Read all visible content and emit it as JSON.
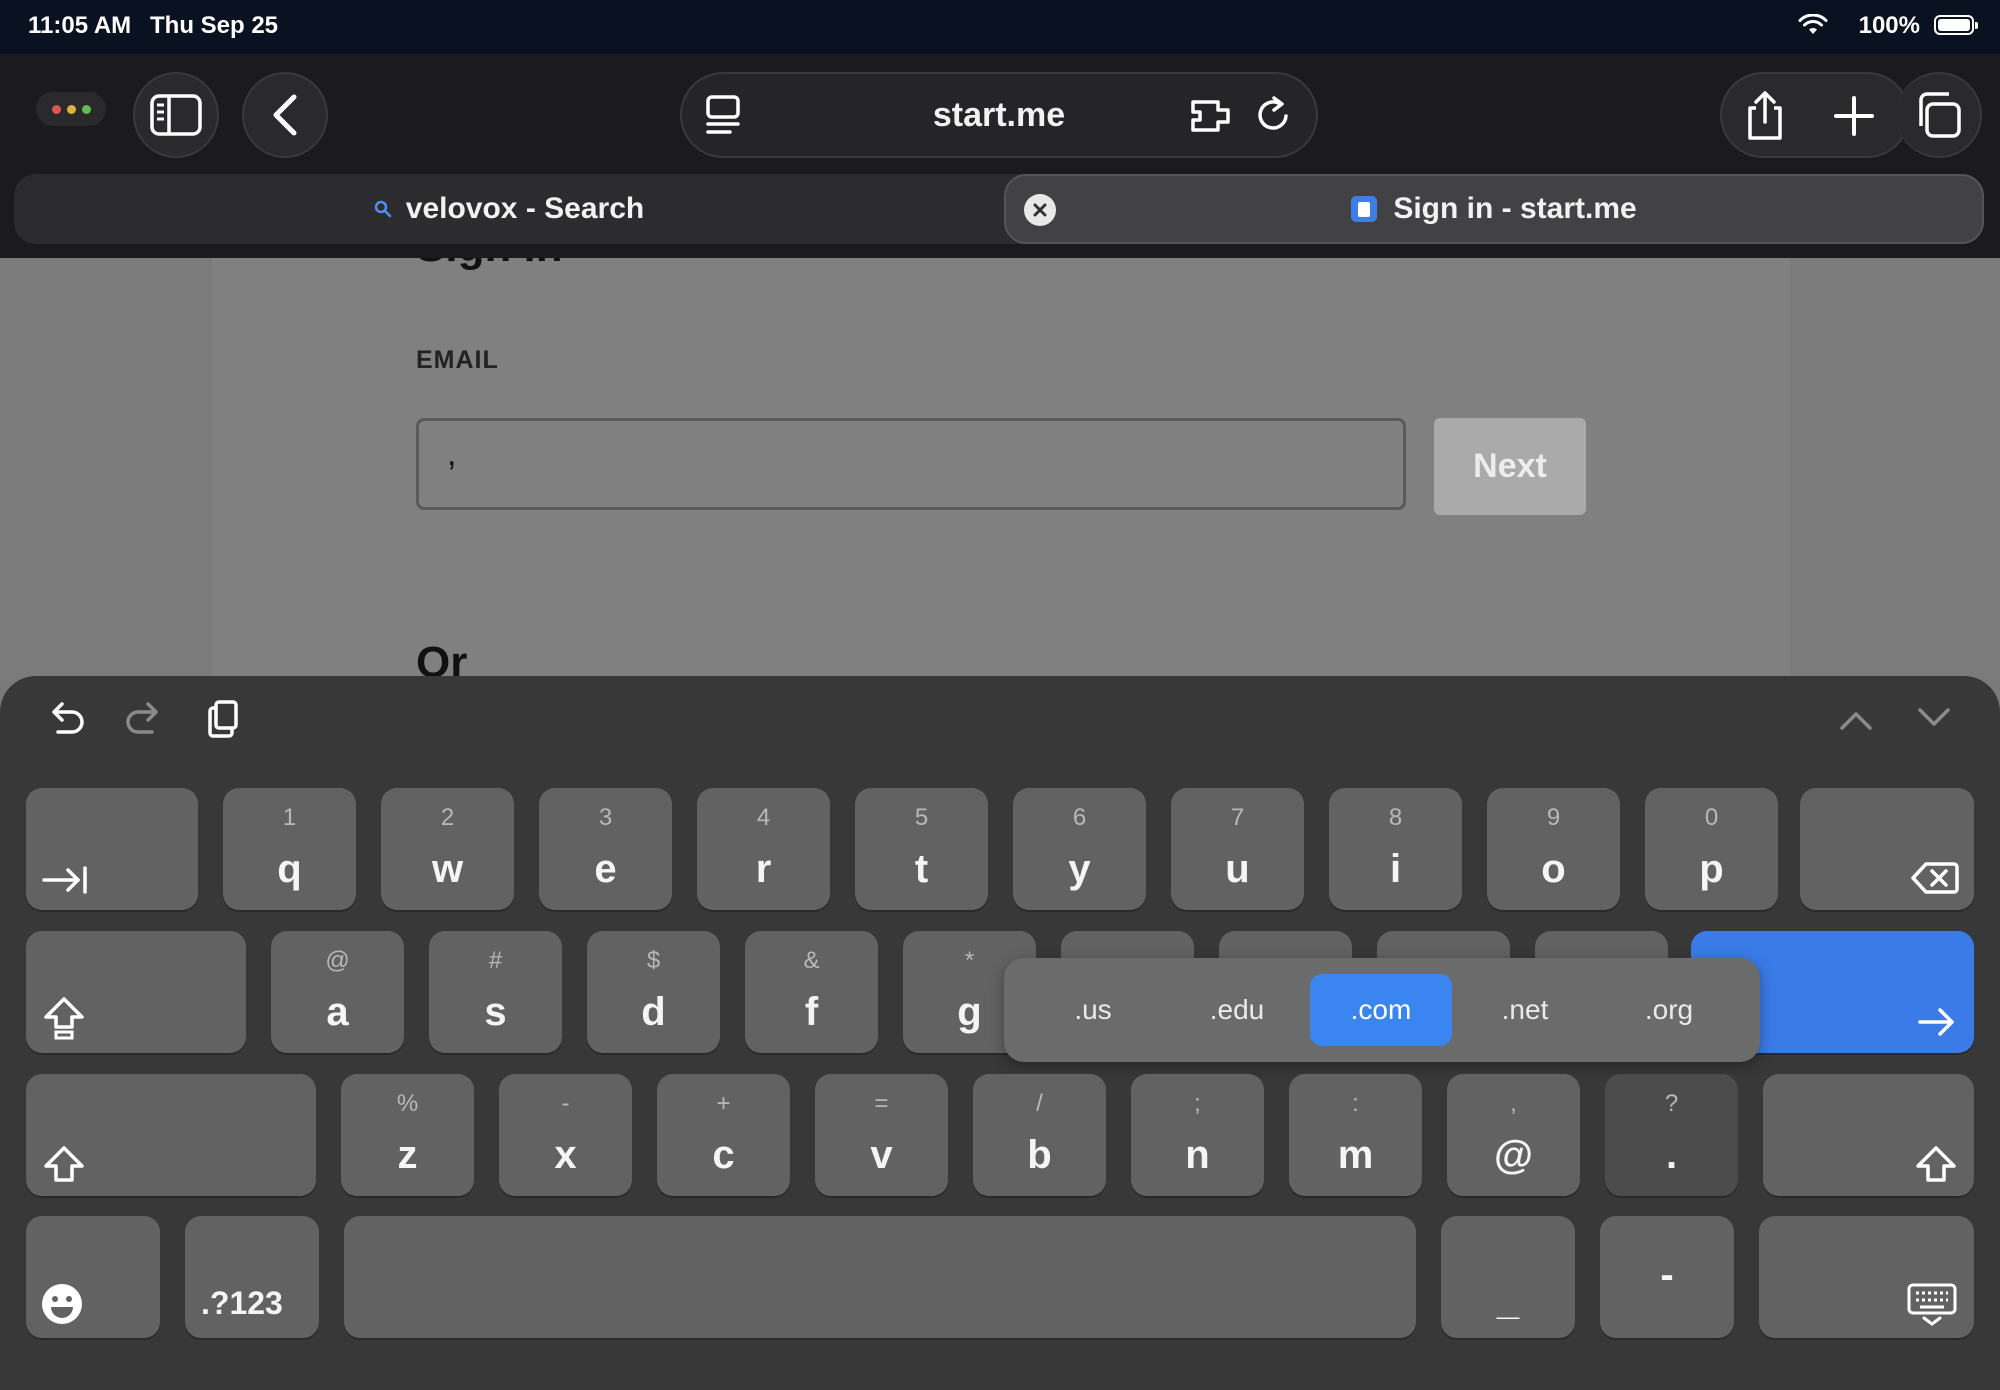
{
  "status_bar": {
    "time": "11:05 AM",
    "date": "Thu Sep 25",
    "battery": "100%"
  },
  "browser": {
    "address": "start.me",
    "tabs": [
      {
        "label": "velovox - Search",
        "icon": "search-icon"
      },
      {
        "label": "Sign in - start.me",
        "icon": "startme-favicon"
      }
    ]
  },
  "page": {
    "heading": "Sign in",
    "email_label": "EMAIL",
    "email_value": ",",
    "next_label": "Next",
    "or_label": "Or"
  },
  "keyboard": {
    "row1": [
      {
        "main": "q",
        "alt": "1"
      },
      {
        "main": "w",
        "alt": "2"
      },
      {
        "main": "e",
        "alt": "3"
      },
      {
        "main": "r",
        "alt": "4"
      },
      {
        "main": "t",
        "alt": "5"
      },
      {
        "main": "y",
        "alt": "6"
      },
      {
        "main": "u",
        "alt": "7"
      },
      {
        "main": "i",
        "alt": "8"
      },
      {
        "main": "o",
        "alt": "9"
      },
      {
        "main": "p",
        "alt": "0"
      }
    ],
    "row2": [
      {
        "main": "a",
        "alt": "@"
      },
      {
        "main": "s",
        "alt": "#"
      },
      {
        "main": "d",
        "alt": "$"
      },
      {
        "main": "f",
        "alt": "&"
      },
      {
        "main": "g",
        "alt": "*"
      }
    ],
    "row3": [
      {
        "main": "z",
        "alt": "%"
      },
      {
        "main": "x",
        "alt": "-"
      },
      {
        "main": "c",
        "alt": "+"
      },
      {
        "main": "v",
        "alt": "="
      },
      {
        "main": "b",
        "alt": "/"
      },
      {
        "main": "n",
        "alt": ";"
      },
      {
        "main": "m",
        "alt": ":"
      },
      {
        "main": "@",
        "alt": ","
      },
      {
        "main": ".",
        "alt": "?"
      }
    ],
    "numbers_key": ".?123",
    "underscore_key": "_",
    "dash_key": "-",
    "domain_suggestions": [
      ".us",
      ".edu",
      ".com",
      ".net",
      ".org"
    ],
    "selected_domain": ".com"
  },
  "colors": {
    "accent": "#3a7be8",
    "selected_domain": "#3a85f0"
  }
}
